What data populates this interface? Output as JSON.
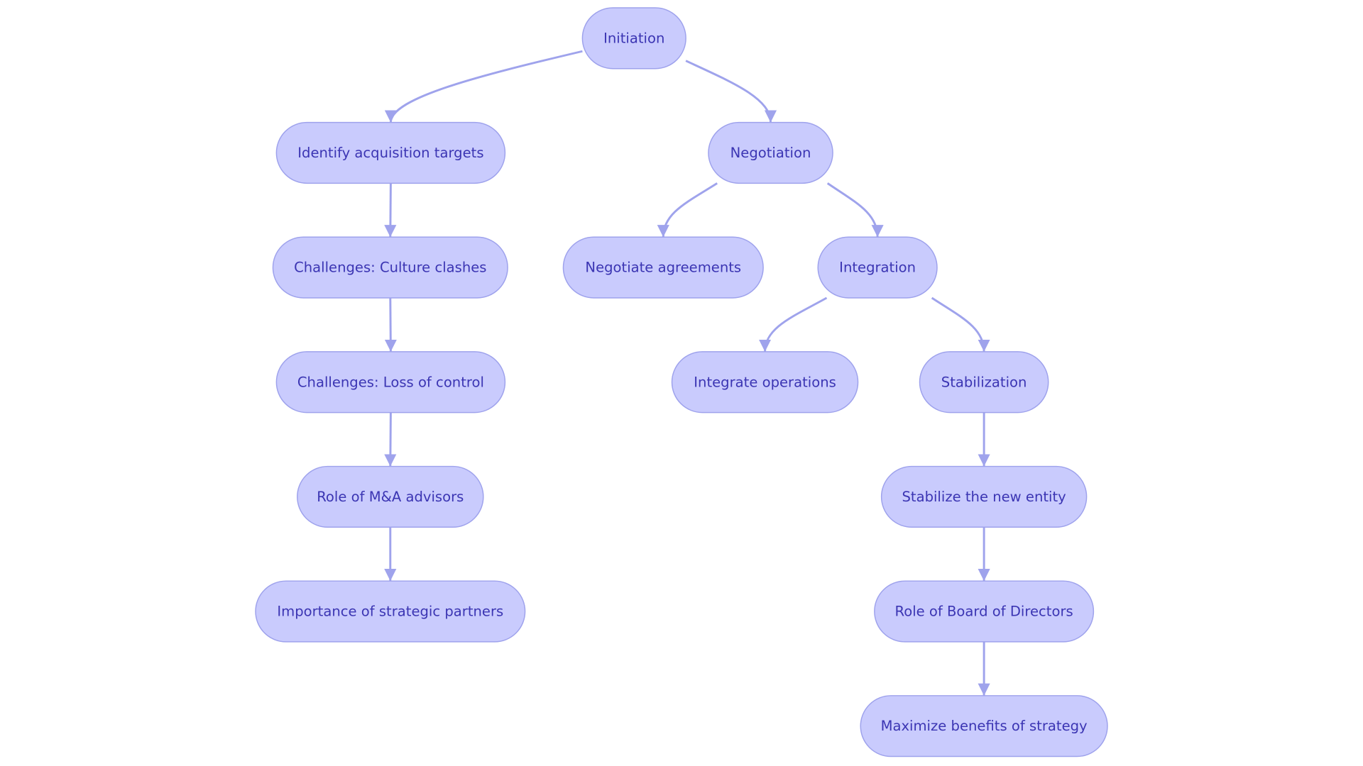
{
  "colors": {
    "node_fill": "#c9cbfd",
    "node_border": "#9ea2ec",
    "edge": "#9fa3ec",
    "text": "#3b35b3"
  },
  "nodes": [
    {
      "id": "initiation",
      "label": "Initiation"
    },
    {
      "id": "identify",
      "label": "Identify acquisition targets"
    },
    {
      "id": "negotiation",
      "label": "Negotiation"
    },
    {
      "id": "culture",
      "label": "Challenges: Culture clashes"
    },
    {
      "id": "agreements",
      "label": "Negotiate agreements"
    },
    {
      "id": "integration",
      "label": "Integration"
    },
    {
      "id": "control",
      "label": "Challenges: Loss of control"
    },
    {
      "id": "operations",
      "label": "Integrate operations"
    },
    {
      "id": "stabilization",
      "label": "Stabilization"
    },
    {
      "id": "advisors",
      "label": "Role of M&A advisors"
    },
    {
      "id": "stabilize",
      "label": "Stabilize the new entity"
    },
    {
      "id": "partners",
      "label": "Importance of strategic partners"
    },
    {
      "id": "board",
      "label": "Role of Board of Directors"
    },
    {
      "id": "maximize",
      "label": "Maximize benefits of strategy"
    }
  ],
  "edges": [
    {
      "from": "initiation",
      "to": "identify"
    },
    {
      "from": "initiation",
      "to": "negotiation"
    },
    {
      "from": "identify",
      "to": "culture"
    },
    {
      "from": "culture",
      "to": "control"
    },
    {
      "from": "control",
      "to": "advisors"
    },
    {
      "from": "advisors",
      "to": "partners"
    },
    {
      "from": "negotiation",
      "to": "agreements"
    },
    {
      "from": "negotiation",
      "to": "integration"
    },
    {
      "from": "integration",
      "to": "operations"
    },
    {
      "from": "integration",
      "to": "stabilization"
    },
    {
      "from": "stabilization",
      "to": "stabilize"
    },
    {
      "from": "stabilize",
      "to": "board"
    },
    {
      "from": "board",
      "to": "maximize"
    }
  ]
}
